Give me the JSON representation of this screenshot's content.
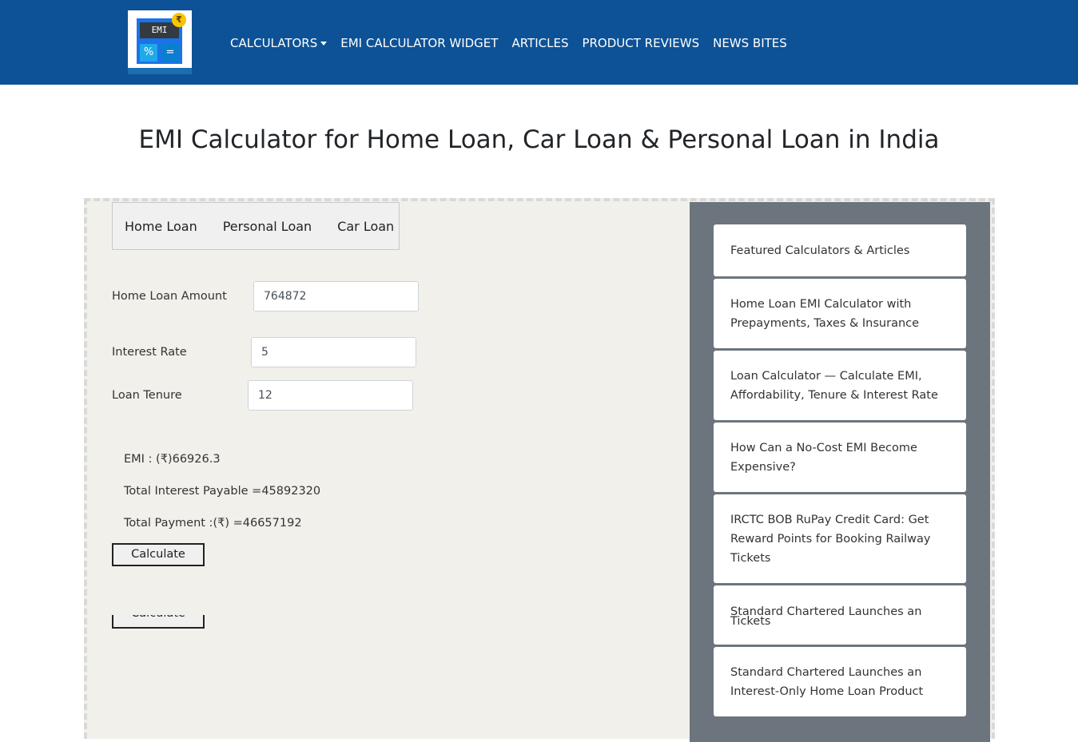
{
  "logo": {
    "screen_text": "EMI",
    "key_left": "%",
    "key_right": "=",
    "coin": "₹"
  },
  "nav": {
    "items": [
      {
        "label": "CALCULATORS",
        "dropdown": true
      },
      {
        "label": "EMI CALCULATOR WIDGET"
      },
      {
        "label": "ARTICLES"
      },
      {
        "label": "PRODUCT REVIEWS"
      },
      {
        "label": "NEWS BITES"
      }
    ]
  },
  "page_title": "EMI Calculator for Home Loan, Car Loan & Personal Loan in India",
  "tabs": [
    "Home Loan",
    "Personal Loan",
    "Car Loan"
  ],
  "form": {
    "amount_label": "Home Loan Amount",
    "amount_value": "764872",
    "rate_label": "Interest Rate",
    "rate_value": "5",
    "tenure_label": "Loan Tenure",
    "tenure_value": "12"
  },
  "results": {
    "emi": "EMI : (₹)66926.3",
    "interest": "Total Interest Payable =45892320",
    "payment": "Total Payment :(₹) =46657192"
  },
  "calculate_label": "Calculate",
  "sidebar": {
    "cards": [
      "Featured Calculators & Articles",
      "Home Loan EMI Calculator with Prepayments, Taxes & Insurance",
      "Loan Calculator — Calculate EMI, Affordability, Tenure & Interest Rate",
      "How Can a No-Cost EMI Become Expensive?",
      "IRCTC BOB RuPay Credit Card: Get Reward Points for Booking Railway Tickets",
      "Standard Chartered Launches an",
      "Tickets",
      "Standard Chartered Launches an Interest-Only Home Loan Product"
    ]
  },
  "colors": {
    "navbar": "#0d5297",
    "sidebar": "#6c757d",
    "panel": "#f1f0ea"
  }
}
